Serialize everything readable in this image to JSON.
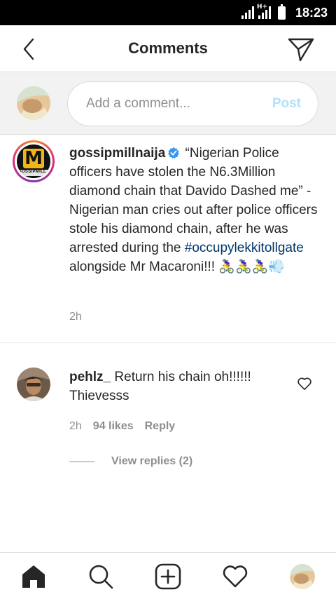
{
  "status_bar": {
    "network_label": "H+",
    "time": "18:23"
  },
  "header": {
    "title": "Comments",
    "back_icon": "chevron-left-icon",
    "send_icon": "paper-plane-icon"
  },
  "comment_input": {
    "placeholder": "Add a comment...",
    "post_label": "Post"
  },
  "caption": {
    "username": "gossipmillnaija",
    "verified": true,
    "text_before_hashtag": "“Nigerian Police officers have stolen the N6.3Million diamond chain that Davido Dashed me” - Nigerian man cries out after police officers stole his diamond chain, after he was arrested during the",
    "hashtag": "#occupylekkitollgate",
    "text_after_hashtag": "alongside Mr Macaroni!!! 🚴‍♀️🚴‍♀️🚴‍♀️💨",
    "time": "2h",
    "avatar_logo_letter": "M",
    "avatar_logo_subtext": "GOSSIPMILL"
  },
  "reply": {
    "username": "pehlz_",
    "text": "Return his chain oh!!!!!! Thievesss",
    "time": "2h",
    "likes": "94 likes",
    "reply_label": "Reply",
    "view_replies": "View replies (2)"
  },
  "bottom_nav": {
    "items": [
      "home-icon",
      "search-icon",
      "add-post-icon",
      "activity-heart-icon",
      "profile-avatar"
    ]
  },
  "colors": {
    "post_button": "#b3dffc",
    "hashtag": "#003569",
    "verified_badge": "#3897f0",
    "secondary_text": "#8e8e8e"
  }
}
